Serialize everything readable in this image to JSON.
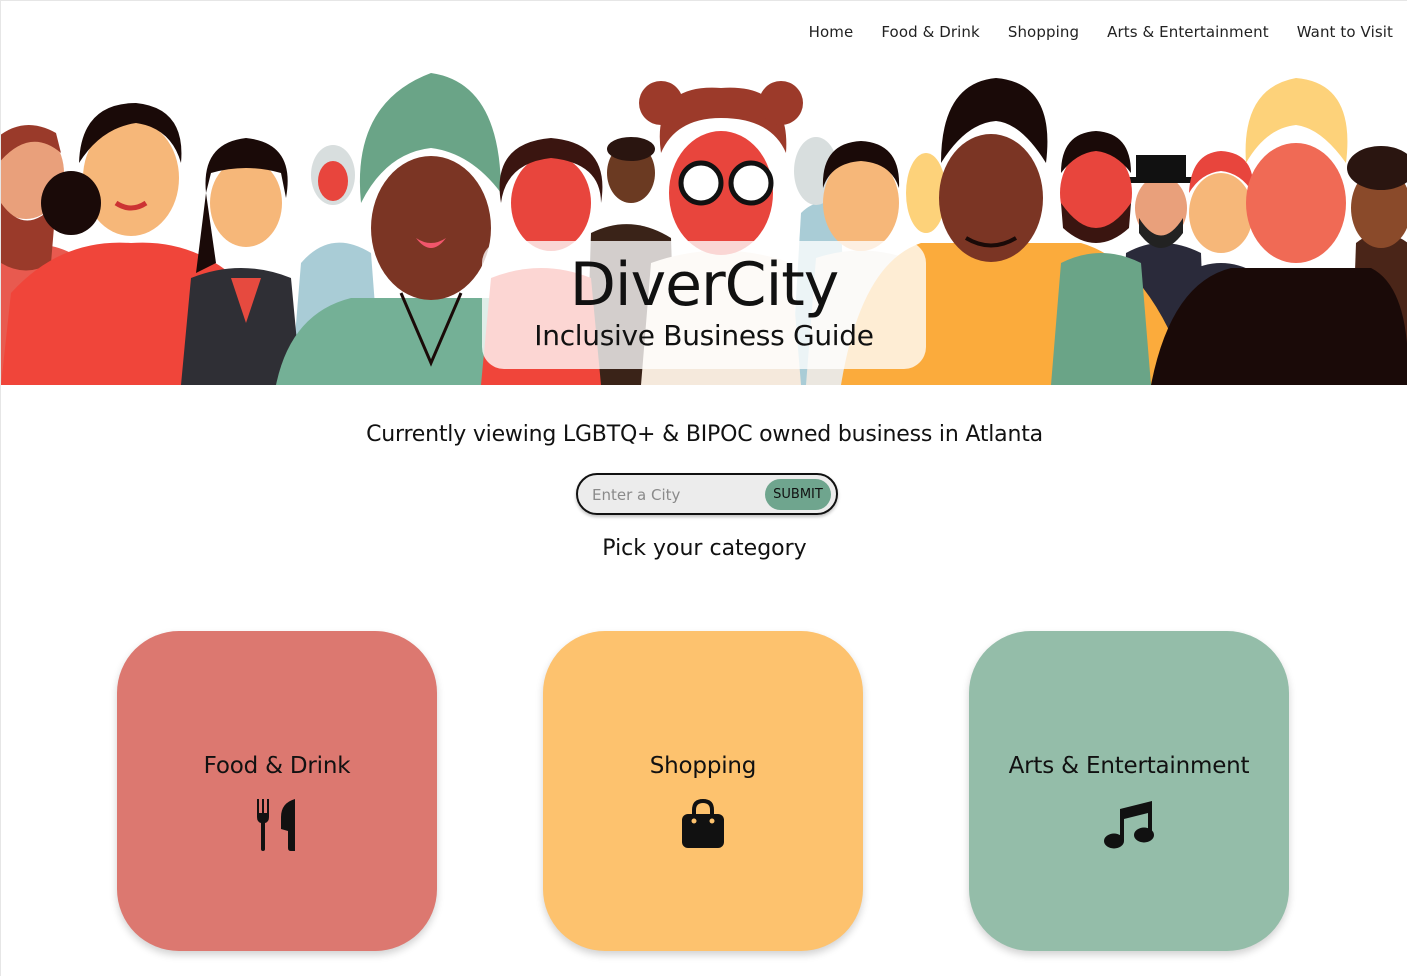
{
  "nav": {
    "items": [
      "Home",
      "Food & Drink",
      "Shopping",
      "Arts & Entertainment",
      "Want to Visit"
    ]
  },
  "hero": {
    "title": "DiverCity",
    "subtitle": "Inclusive Business Guide",
    "image": "diverse-people-illustration"
  },
  "main": {
    "viewing_text": "Currently viewing LGBTQ+ & BIPOC owned business in Atlanta",
    "search": {
      "placeholder": "Enter a City",
      "value": "",
      "submit_label": "SUBMIT"
    },
    "pick_heading": "Pick your category"
  },
  "categories": [
    {
      "label": "Food & Drink",
      "icon": "utensils-icon",
      "color": "#dc7870"
    },
    {
      "label": "Shopping",
      "icon": "shopping-bag-icon",
      "color": "#fdc26e"
    },
    {
      "label": "Arts & Entertainment",
      "icon": "music-note-icon",
      "color": "#94bda9"
    }
  ],
  "colors": {
    "submit_button": "#6fa58e"
  }
}
